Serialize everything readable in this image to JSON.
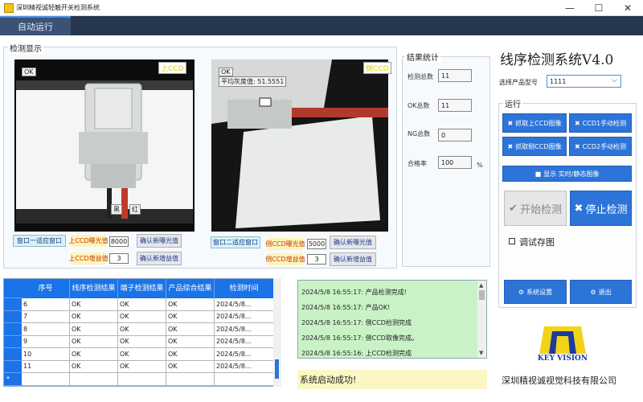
{
  "window": {
    "title": "深圳精视诚轻触开关检测系统",
    "minimize_glyph": "—",
    "maximize_glyph": "☐",
    "close_glyph": "✕"
  },
  "tabs": [
    {
      "label": "自动运行"
    }
  ],
  "detection": {
    "group_title": "检测显示",
    "cam1": {
      "tag": "上CCD",
      "ok": "OK",
      "label_black": "黑",
      "label_red": "红",
      "fit_button": "窗口一适应窗口",
      "exposure_label": "上CCD曝光值",
      "exposure_value": "8000",
      "confirm_exposure": "确认新曝光值",
      "gain_label": "上CCD增益值",
      "gain_value": "3",
      "confirm_gain": "确认新增益值"
    },
    "cam2": {
      "tag": "侧CCD",
      "ok": "OK",
      "avg_gray": "平均灰度值: 51.5551",
      "fit_button": "窗口二适应窗口",
      "exposure_label": "侧CCD曝光值",
      "exposure_value": "5000",
      "confirm_exposure": "确认新曝光值",
      "gain_label": "侧CCD增益值",
      "gain_value": "3",
      "confirm_gain": "确认新增益值"
    }
  },
  "results": {
    "group_title": "结果统计",
    "total_label": "检测总数",
    "total_value": "11",
    "ok_label": "OK总数",
    "ok_value": "11",
    "ng_label": "NG总数",
    "ng_value": "0",
    "pass_label": "合格率",
    "pass_value": "100",
    "pass_unit": "%"
  },
  "right": {
    "system_title": "线序检测系统V4.0",
    "model_label": "选择产品型号",
    "model_value": "1111",
    "run_group_title": "运行",
    "btn_grab_top": "抓取上CCD图像",
    "btn_ccd1_manual": "CCD1手动检测",
    "btn_grab_side": "抓取侧CCD图像",
    "btn_ccd2_manual": "CCD2手动检测",
    "btn_display": "显示 实时/静态图像",
    "btn_start": "开始检测",
    "btn_stop": "停止检测",
    "debug_save": "调试存图",
    "btn_settings": "系统设置",
    "btn_exit": "退出"
  },
  "grid": {
    "columns": [
      "序号",
      "线序检测结果",
      "端子检测结果",
      "产品综合结果",
      "检测时间"
    ],
    "rows": [
      [
        "6",
        "OK",
        "OK",
        "OK",
        "2024/5/8..."
      ],
      [
        "7",
        "OK",
        "OK",
        "OK",
        "2024/5/8..."
      ],
      [
        "8",
        "OK",
        "OK",
        "OK",
        "2024/5/8..."
      ],
      [
        "9",
        "OK",
        "OK",
        "OK",
        "2024/5/8..."
      ],
      [
        "10",
        "OK",
        "OK",
        "OK",
        "2024/5/8..."
      ],
      [
        "11",
        "OK",
        "OK",
        "OK",
        "2024/5/8..."
      ]
    ],
    "new_row_marker": "*"
  },
  "log": [
    "2024/5/8 16:55:17: 产品检测完成!",
    "2024/5/8 16:55:17: 产品OK!",
    "2024/5/8 16:55:17: 侧CCD检测完成",
    "2024/5/8 16:55:17: 侧CCD取像完成。",
    "2024/5/8 16:55:16: 上CCD检测完成"
  ],
  "status_text": "系统启动成功!",
  "logo_text": "KEY VISION",
  "company": "深圳精视诚视觉科技有限公司",
  "colors": {
    "accent_blue": "#2d74d9",
    "tab_bg": "#26374f",
    "log_bg": "#c9f3c6",
    "status_bg": "#fbf6c4",
    "cam_tag_text": "#e4d000"
  }
}
